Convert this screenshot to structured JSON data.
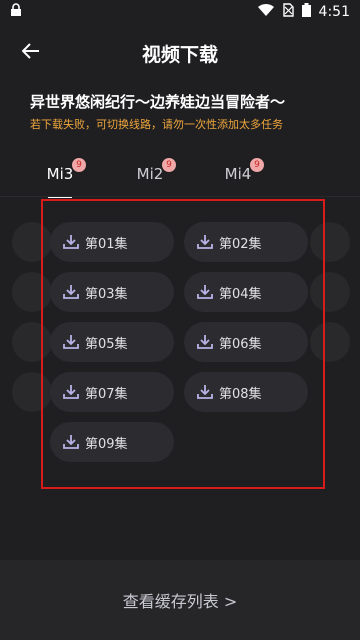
{
  "status": {
    "time": "4:51"
  },
  "header": {
    "title": "视频下载"
  },
  "info": {
    "title": "异世界悠闲纪行～边养娃边当冒险者～",
    "note": "若下载失败，可切换线路，请勿一次性添加太多任务"
  },
  "tabs": [
    {
      "label": "Mi3",
      "badge": "9",
      "active": true
    },
    {
      "label": "Mi2",
      "badge": "9",
      "active": false
    },
    {
      "label": "Mi4",
      "badge": "9",
      "active": false
    }
  ],
  "episodes": [
    "第01集",
    "第02集",
    "第03集",
    "第04集",
    "第05集",
    "第06集",
    "第07集",
    "第08集",
    "第09集"
  ],
  "footer": {
    "label": "查看缓存列表 >"
  },
  "colors": {
    "accent_note": "#f0a73c",
    "highlight": "#d81b1b",
    "icon": "#b8b3e6"
  }
}
